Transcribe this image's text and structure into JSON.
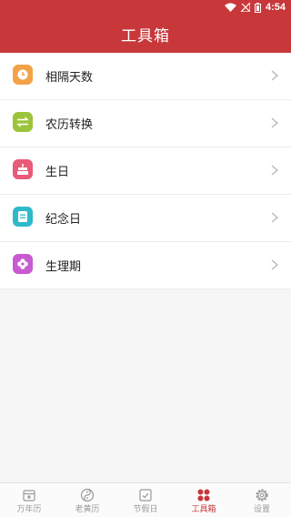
{
  "status_bar": {
    "time": "4:54"
  },
  "header": {
    "title": "工具箱"
  },
  "tools": [
    {
      "label": "相隔天数",
      "icon": "clock-icon",
      "color": "#f2a34a"
    },
    {
      "label": "农历转换",
      "icon": "swap-arrows-icon",
      "color": "#9cc43a"
    },
    {
      "label": "生日",
      "icon": "cake-icon",
      "color": "#e85a78"
    },
    {
      "label": "纪念日",
      "icon": "note-icon",
      "color": "#2fb9c9"
    },
    {
      "label": "生理期",
      "icon": "flower-icon",
      "color": "#c85ad2"
    }
  ],
  "tabbar": {
    "tabs": [
      {
        "label": "万年历",
        "icon": "calendar-icon"
      },
      {
        "label": "老黄历",
        "icon": "yinyang-icon"
      },
      {
        "label": "节假日",
        "icon": "holiday-check-icon"
      },
      {
        "label": "工具箱",
        "icon": "toolbox-icon",
        "active": true
      },
      {
        "label": "设置",
        "icon": "gear-icon"
      }
    ]
  },
  "colors": {
    "brand": "#c8373a",
    "inactive": "#9a9a9a"
  }
}
